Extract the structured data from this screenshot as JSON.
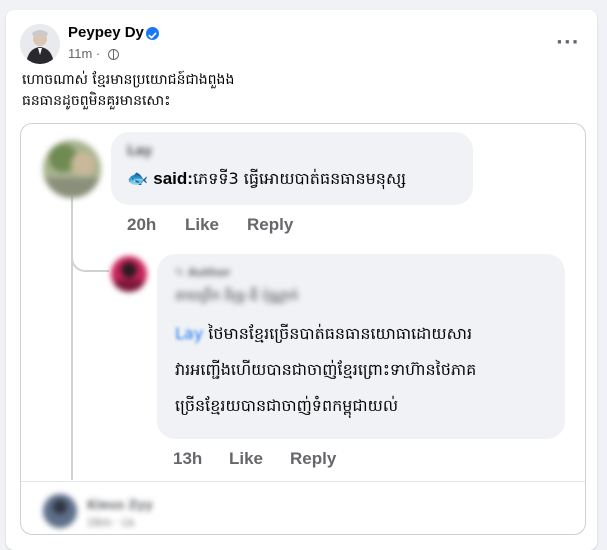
{
  "post": {
    "author": "Peypey Dy",
    "time": "11m ·",
    "text_line1": "ហោចណាស់ ខ្មែរមានប្រយោជន៍ជាងពួងង",
    "text_line2": "ធនធានដូចពួមិនគួរមានសោះ"
  },
  "comment1": {
    "author": "Lay",
    "emoji": "🐟",
    "text_prefix": "said:",
    "text": "ភេទទី3 ធ្វើអោយបាត់ធនធានមនុស្ស",
    "time": "20h",
    "like": "Like",
    "reply": "Reply"
  },
  "comment2": {
    "badge": "Author",
    "author": "នាយព្រឹក ពិរុទ្ធ-ឌី ប៉ុណ្ណាក់",
    "mention": "Lay",
    "line1": "ថៃមានខ្មែរច្រើនបាត់ធនធានយោធាដោយសារ",
    "line2": "វារអញ្ជើងហើយបានជាចាញ់ខ្មែរព្រោះទាហ៊ានថៃភាគ",
    "line3": "ច្រើនខ្មែរយបានជាចាញ់ទំពកម្ពុជាយល់",
    "time": "13h",
    "like": "Like",
    "reply": "Reply"
  },
  "comment3": {
    "author": "Kieus Zyy",
    "time": "16m · Lk"
  },
  "colors": {
    "verified": "#1877f2",
    "mention": "#1877f2",
    "secondary_text": "#65676b",
    "action_text": "#65676b"
  },
  "icons": [
    "verified-badge-icon",
    "globe-icon",
    "more-options-icon",
    "fish-emoji-icon",
    "pencil-icon"
  ]
}
